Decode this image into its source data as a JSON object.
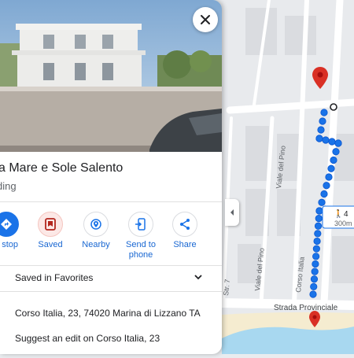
{
  "place": {
    "title": "sa Mare e Sole Salento",
    "subtitle": "ding",
    "close_icon": "close-icon"
  },
  "actions": [
    {
      "label": "d stop",
      "icon": "directions-icon"
    },
    {
      "label": "Saved",
      "icon": "bookmark-icon"
    },
    {
      "label": "Nearby",
      "icon": "nearby-icon"
    },
    {
      "label_line1": "Send to",
      "label_line2": "phone",
      "icon": "send-to-phone-icon"
    },
    {
      "label": "Share",
      "icon": "share-icon"
    }
  ],
  "saved_row": {
    "text": "Saved in Favorites"
  },
  "address_row": {
    "text": "Corso Italia, 23, 74020 Marina di Lizzano TA"
  },
  "suggest_row": {
    "text": "Suggest an edit on Corso Italia, 23"
  },
  "map": {
    "street_labels": {
      "viale_del_pino_top": "Viale del Pino",
      "viale_del_pino_bottom": "Viale del Pino",
      "corso_italia": "Corso Italia",
      "str": "Str. 7",
      "strada_provinciale": "Strada Provinciale"
    },
    "walk_badge": {
      "duration": "4",
      "distance": "300m"
    },
    "colors": {
      "route": "#1a73e8",
      "pin": "#d93025",
      "sea": "#a8d8f0",
      "sand": "#f5ecd0"
    }
  }
}
